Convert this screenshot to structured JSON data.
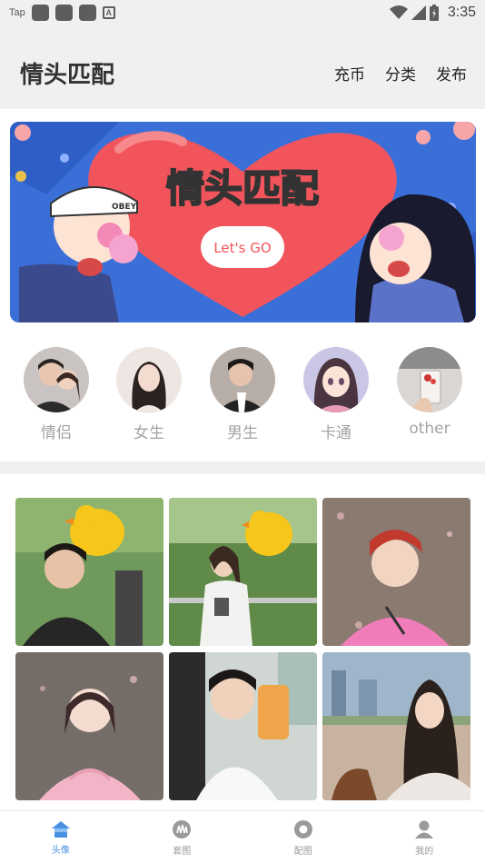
{
  "status_bar": {
    "app": "Tap",
    "time": "3:35"
  },
  "header": {
    "title": "情头匹配",
    "actions": [
      "充币",
      "分类",
      "发布"
    ]
  },
  "banner": {
    "title": "情头匹配",
    "badge": "Let's GO",
    "cap_text": "OBEY"
  },
  "categories": [
    {
      "label": "情侣"
    },
    {
      "label": "女生"
    },
    {
      "label": "男生"
    },
    {
      "label": "卡通"
    },
    {
      "label": "other"
    }
  ],
  "bottom_nav": [
    {
      "label": "头像",
      "icon": "home-icon",
      "active": true
    },
    {
      "label": "套图",
      "icon": "album-icon",
      "active": false
    },
    {
      "label": "配图",
      "icon": "circle-icon",
      "active": false
    },
    {
      "label": "我的",
      "icon": "user-icon",
      "active": false
    }
  ],
  "colors": {
    "accent": "#4a90e2",
    "banner_bg": "#3b6fd8",
    "banner_heart": "#f2545b"
  }
}
